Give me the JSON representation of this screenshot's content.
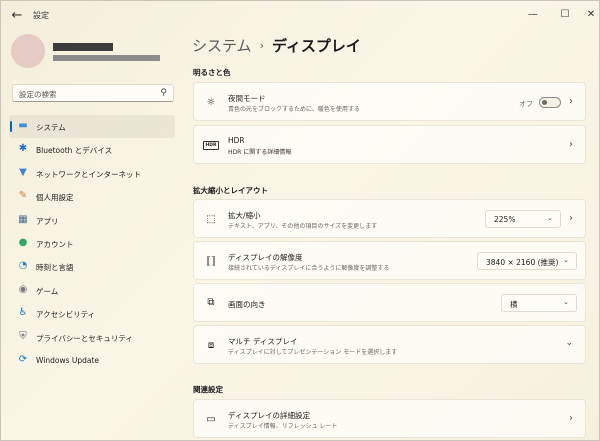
{
  "app": {
    "title": "設定"
  },
  "titlebar": {
    "back": "←",
    "minimize": "—",
    "maximize": "☐",
    "close": "✕"
  },
  "search": {
    "placeholder": "設定の検索",
    "icon": "search-icon"
  },
  "sidebar": {
    "items": [
      {
        "label": "システム",
        "icon": "monitor-icon",
        "glyph": "▬",
        "color": "#3b8fd9",
        "active": true
      },
      {
        "label": "Bluetooth とデバイス",
        "icon": "bluetooth-icon",
        "glyph": "✱",
        "color": "#1e6fd0"
      },
      {
        "label": "ネットワークとインターネット",
        "icon": "wifi-icon",
        "glyph": "▼",
        "color": "#3a86d4"
      },
      {
        "label": "個人用設定",
        "icon": "brush-icon",
        "glyph": "✎",
        "color": "#d07a3a"
      },
      {
        "label": "アプリ",
        "icon": "apps-icon",
        "glyph": "▦",
        "color": "#4a6b8a"
      },
      {
        "label": "アカウント",
        "icon": "person-icon",
        "glyph": "●",
        "color": "#2ea56a"
      },
      {
        "label": "時刻と言語",
        "icon": "globe-clock-icon",
        "glyph": "◔",
        "color": "#2a7fc9"
      },
      {
        "label": "ゲーム",
        "icon": "gamepad-icon",
        "glyph": "◉",
        "color": "#7a7a7a"
      },
      {
        "label": "アクセシビリティ",
        "icon": "accessibility-icon",
        "glyph": "♿",
        "color": "#1b72c8"
      },
      {
        "label": "プライバシーとセキュリティ",
        "icon": "shield-icon",
        "glyph": "⛨",
        "color": "#6a6a74"
      },
      {
        "label": "Windows Update",
        "icon": "update-icon",
        "glyph": "⟳",
        "color": "#1a73c8"
      }
    ]
  },
  "breadcrumb": {
    "parent": "システム",
    "separator": "›",
    "current": "ディスプレイ"
  },
  "sections": {
    "brightness": "明るさと色",
    "scale_layout": "拡大縮小とレイアウト",
    "related": "関連設定"
  },
  "cards": {
    "night_light": {
      "title": "夜間モード",
      "desc": "青色の光をブロックするために、暖色を使用する",
      "toggle_label": "オフ",
      "toggle_on": false
    },
    "hdr": {
      "title": "HDR",
      "desc": "HDR に関する詳細情報",
      "icon_text": "HDR"
    },
    "scale": {
      "title": "拡大/縮小",
      "desc": "テキスト、アプリ、その他の項目のサイズを変更します",
      "value": "225%"
    },
    "resolution": {
      "title": "ディスプレイの解像度",
      "desc": "接続されているディスプレイに合うように解像度を調整する",
      "value": "3840 × 2160 (推奨)"
    },
    "orientation": {
      "title": "画面の向き",
      "value": "横"
    },
    "multi_display": {
      "title": "マルチ ディスプレイ",
      "desc": "ディスプレイに対してプレゼンテーション モードを選択します"
    },
    "advanced": {
      "title": "ディスプレイの詳細設定",
      "desc": "ディスプレイ情報、リフレッシュ レート"
    }
  },
  "colors": {
    "accent": "#0067c0"
  }
}
